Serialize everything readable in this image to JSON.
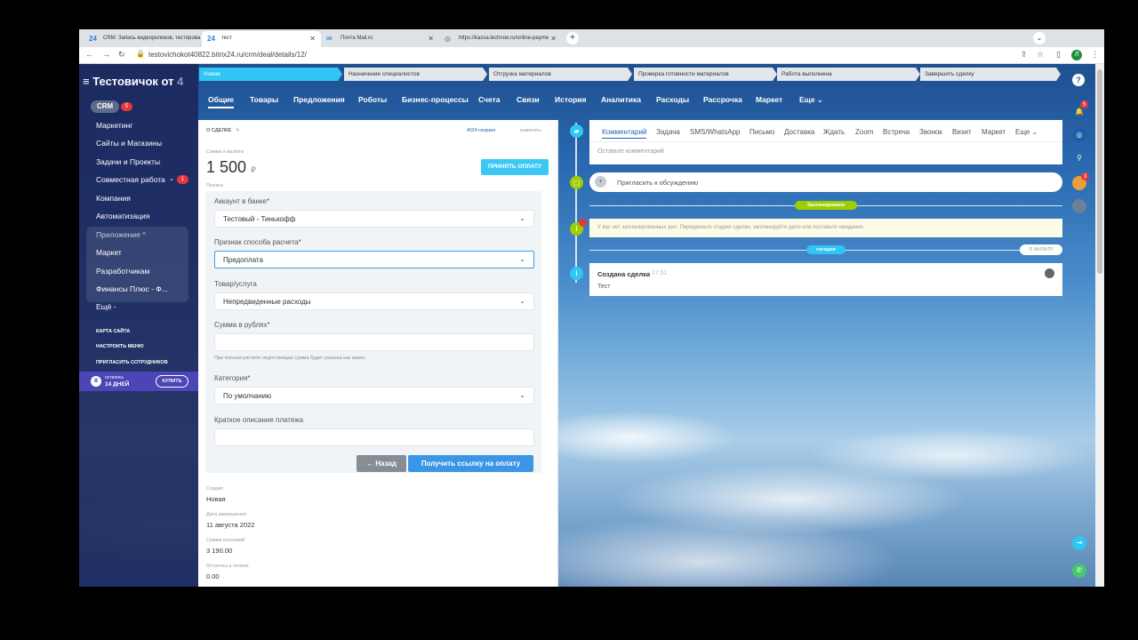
{
  "browser": {
    "tabs": [
      {
        "fav": "24",
        "title": "CRM: Запись видеороликов, тестирова"
      },
      {
        "fav": "24",
        "title": "тест"
      },
      {
        "fav": "✉",
        "title": "Почта Mail.ru"
      },
      {
        "fav": "◎",
        "title": "https://kassa.lechnoe.ru/online-payme"
      }
    ],
    "new_tab": "+",
    "tab_menu": "⌄",
    "url": "testovichokot40822.bitrix24.ru/crm/deal/details/12/",
    "profile_letter": "Л"
  },
  "sidebar": {
    "logo_main": "Тестовичок от ",
    "logo_muted": "4",
    "menu_icon": "≡",
    "crm_label": "CRM",
    "crm_count": "5",
    "items": [
      "Маркетинг",
      "Сайты и Магазины",
      "Задачи и Проекты",
      "Совместная работа",
      "Компания",
      "Автоматизация",
      "Приложения ^",
      "Маркет",
      "Разработчикам",
      "Финансы Плюс - Ф...",
      "Ещё -"
    ],
    "collab_chev": "⌄",
    "collab_count": "1",
    "small_links": [
      "КАРТА САЙТА",
      "НАСТРОИТЬ МЕНЮ",
      "ПРИГЛАСИТЬ СОТРУДНИКОВ"
    ],
    "promo": {
      "line1": "осталось",
      "line2": "14 ДНЕЙ",
      "buy": "КУПИТЬ"
    }
  },
  "stages": [
    "Новая",
    "Назначение специалистов",
    "Отгрузка материалов",
    "Проверка готовности материалов",
    "Работа выполнена",
    "Завершить сделку"
  ],
  "deal_tabs": [
    "Общие",
    "Товары",
    "Предложения",
    "Роботы",
    "Бизнес-процессы",
    "Счета",
    "Связи",
    "История",
    "Аналитика",
    "Расходы",
    "Рассрочка",
    "Маркет",
    "Еще ⌄"
  ],
  "left": {
    "section": "О СДЕЛКЕ",
    "scoring": "AI24-скоринг",
    "change": "изменить",
    "sum_label": "Сумма и валюта",
    "sum_value": "1 500",
    "currency": "₽",
    "accept_btn": "ПРИНЯТЬ ОПЛАТУ",
    "payment_label": "Оплата",
    "form": {
      "bank_label": "Аккаунт в банке*",
      "bank_value": "Тестовый - Тинькофф",
      "method_label": "Признак способа расчета*",
      "method_value": "Предоплата",
      "product_label": "Товар/услуга",
      "product_value": "Непредвиденные расходы",
      "amount_label": "Сумма в рублях*",
      "amount_value": "",
      "hint": "При полном расчете недостающая сумма будет указана как аванс.",
      "category_label": "Категория*",
      "category_value": "По умолчанию",
      "desc_label": "Краткое описание платежа",
      "desc_value": "",
      "back_btn": "← Назад",
      "pay_btn": "Получить ссылку на оплату"
    },
    "info": [
      {
        "label": "Стадия",
        "value": "Новая"
      },
      {
        "label": "Дата завершения",
        "value": "11 августа 2022"
      },
      {
        "label": "Сумма платежей",
        "value": "3 190.00"
      },
      {
        "label": "Осталось к оплате",
        "value": "0.00"
      }
    ]
  },
  "timeline": {
    "tabs": [
      "Комментарий",
      "Задача",
      "SMS/WhatsApp",
      "Письмо",
      "Доставка",
      "Ждать",
      "Zoom",
      "Встреча",
      "Звонок",
      "Визит",
      "Маркет",
      "Еще ⌄"
    ],
    "comment_placeholder": "Оставьте комментарий",
    "invite": "Пригласить к обсуждению",
    "planned_pill": "Запланировано",
    "no_tasks": "У вас нет запланированных дел. Передвиньте стадию сделки, запланируйте дело или поставьте ожидание.",
    "today_pill": "сегодня",
    "filter": "ФИЛЬТР",
    "created_title": "Создана сделка",
    "created_time": "17:51",
    "created_text": "Тест",
    "notif_count": "5",
    "avatar_count": "3"
  },
  "colors": {
    "accent": "#2fc6f6",
    "primary": "#3b96e6",
    "sidebar": "#1c285c",
    "green": "#9dcf00"
  }
}
